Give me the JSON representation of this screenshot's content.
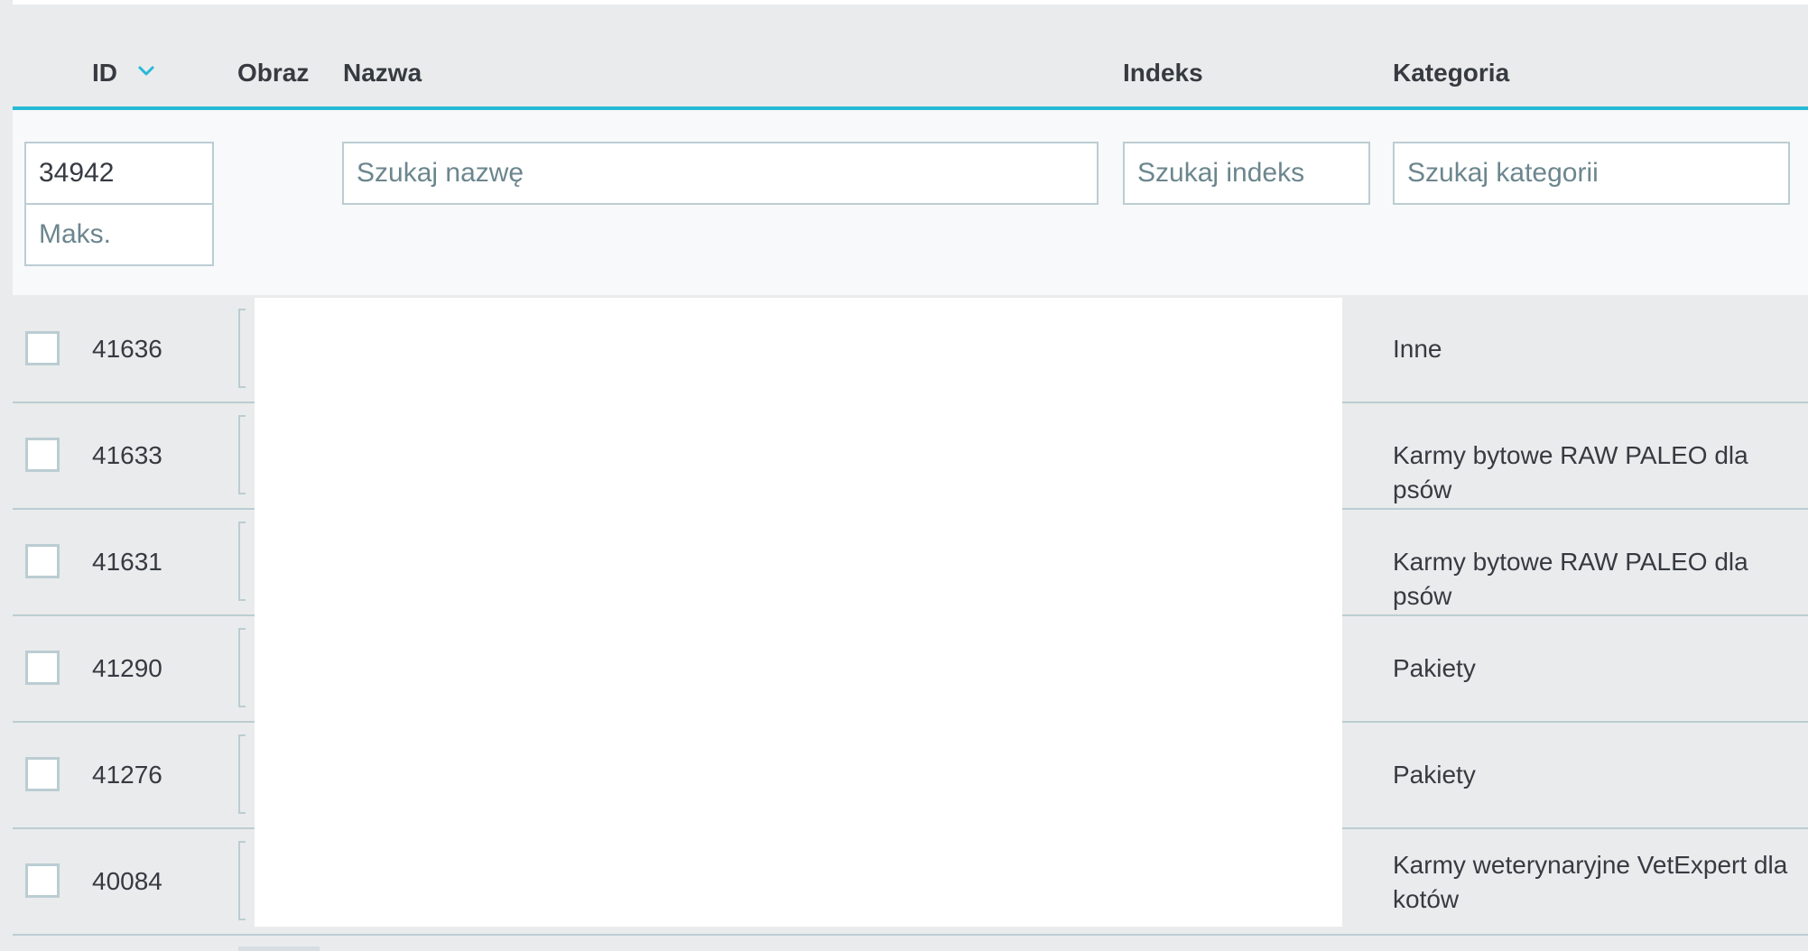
{
  "columns": {
    "id": "ID",
    "image": "Obraz",
    "name": "Nazwa",
    "index": "Indeks",
    "category": "Kategoria"
  },
  "filters": {
    "id_min_value": "34942",
    "id_max_placeholder": "Maks.",
    "name_placeholder": "Szukaj nazwę",
    "index_placeholder": "Szukaj indeks",
    "category_placeholder": "Szukaj kategorii"
  },
  "rows": [
    {
      "id": "41636",
      "category": "Inne"
    },
    {
      "id": "41633",
      "category": "Karmy bytowe RAW PALEO dla psów"
    },
    {
      "id": "41631",
      "category": "Karmy bytowe RAW PALEO dla psów"
    },
    {
      "id": "41290",
      "category": "Pakiety"
    },
    {
      "id": "41276",
      "category": "Pakiety"
    },
    {
      "id": "40084",
      "category": "Karmy weterynaryjne VetExpert dla kotów"
    }
  ],
  "icons": {
    "sort": "chevron-down-icon"
  },
  "colors": {
    "accent": "#25b9d7",
    "border": "#bbcdd2",
    "text": "#363a41",
    "placeholder": "#6c868e"
  }
}
